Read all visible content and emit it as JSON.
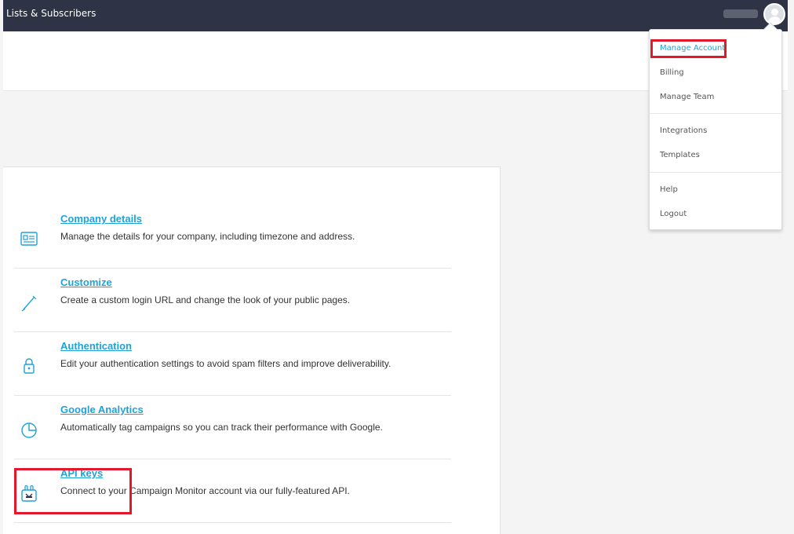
{
  "topbar": {
    "title": "Lists & Subscribers"
  },
  "dropdown": {
    "items": [
      {
        "label": "Manage Account",
        "active": true
      },
      {
        "label": "Billing"
      },
      {
        "label": "Manage Team"
      },
      {
        "label": "Integrations"
      },
      {
        "label": "Templates"
      },
      {
        "label": "Help"
      },
      {
        "label": "Logout"
      }
    ]
  },
  "settings": [
    {
      "title": "Company details",
      "description": "Manage the details for your company, including timezone and address.",
      "icon": "company-card-icon"
    },
    {
      "title": "Customize",
      "description": "Create a custom login URL and change the look of your public pages.",
      "icon": "pen-icon"
    },
    {
      "title": "Authentication",
      "description": "Edit your authentication settings to avoid spam filters and improve deliverability.",
      "icon": "lock-icon"
    },
    {
      "title": "Google Analytics",
      "description": "Automatically tag campaigns so you can track their performance with Google.",
      "icon": "pie-chart-icon"
    },
    {
      "title": "API keys",
      "description": "Connect to your Campaign Monitor account via our fully-featured API.",
      "icon": "api-keys-icon"
    }
  ],
  "colors": {
    "topbar": "#2e3445",
    "link": "#1ea2d8",
    "highlight": "#e3192b"
  }
}
